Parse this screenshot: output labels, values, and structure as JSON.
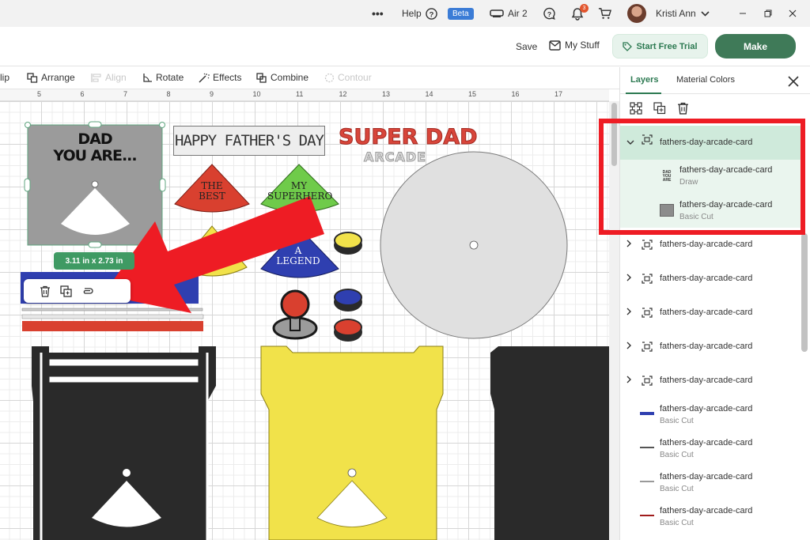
{
  "topbar": {
    "more": "•••",
    "help": "Help",
    "beta": "Beta",
    "machine": "Air 2",
    "notifications_count": "3",
    "user": "Kristi Ann"
  },
  "header": {
    "save": "Save",
    "my_stuff": "My Stuff",
    "start_trial": "Start Free Trial",
    "make": "Make"
  },
  "toolbar": {
    "flip": "lip",
    "arrange": "Arrange",
    "align": "Align",
    "rotate": "Rotate",
    "effects": "Effects",
    "combine": "Combine",
    "contour": "Contour"
  },
  "ruler": [
    "5",
    "6",
    "7",
    "8",
    "9",
    "10",
    "11",
    "12",
    "13",
    "14",
    "15",
    "16",
    "17"
  ],
  "canvas": {
    "selection_size": "3.11  in x 2.73  in",
    "dad_line1": "DAD",
    "dad_line2": "YOU ARE...",
    "happy": "HAPPY FATHER'S DAY",
    "super_dad": "SUPER DAD",
    "arcade": "ARCADE",
    "wedge_best_1": "THE",
    "wedge_best_2": "BEST",
    "wedge_hero_1": "MY",
    "wedge_hero_2": "SUPERHERO",
    "wedge_legend_1": "A",
    "wedge_legend_2": "LEGEND",
    "colors": {
      "gray_card": "#9b9b9b",
      "red": "#d9402f",
      "green": "#6fcb4a",
      "blue": "#2f3fb0",
      "yellow": "#f1e24a",
      "black": "#2a2a2a",
      "arrow": "#ee1c24"
    }
  },
  "panel": {
    "tab_layers": "Layers",
    "tab_material": "Material Colors",
    "layers": [
      {
        "name": "fathers-day-arcade-card",
        "expanded": true
      },
      {
        "name": "fathers-day-arcade-card",
        "sub": "Draw"
      },
      {
        "name": "fathers-day-arcade-card",
        "sub": "Basic Cut"
      },
      {
        "name": "fathers-day-arcade-card"
      },
      {
        "name": "fathers-day-arcade-card"
      },
      {
        "name": "fathers-day-arcade-card"
      },
      {
        "name": "fathers-day-arcade-card"
      },
      {
        "name": "fathers-day-arcade-card"
      },
      {
        "name": "fathers-day-arcade-card",
        "sub": "Basic Cut",
        "color": "#2f3fb0"
      },
      {
        "name": "fathers-day-arcade-card",
        "sub": "Basic Cut",
        "color": "#555555"
      },
      {
        "name": "fathers-day-arcade-card",
        "sub": "Basic Cut",
        "color": "#9a9a9a"
      },
      {
        "name": "fathers-day-arcade-card",
        "sub": "Basic Cut",
        "color": "#a01c1c"
      }
    ]
  }
}
